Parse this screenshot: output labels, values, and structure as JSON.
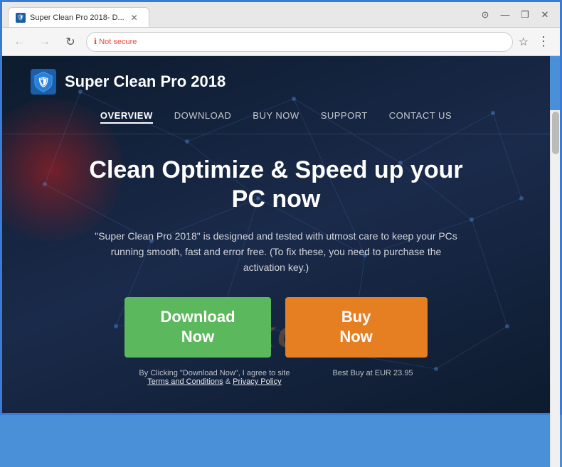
{
  "browser": {
    "tab_title": "Super Clean Pro 2018- D...",
    "tab_favicon": "🛡",
    "window_controls": {
      "account_icon": "⊙",
      "minimize": "—",
      "restore": "❐",
      "close": "✕"
    },
    "nav": {
      "back": "←",
      "forward": "→",
      "refresh": "↻",
      "security_label": "Not secure",
      "address": "",
      "star": "☆",
      "more": "⋮"
    }
  },
  "site": {
    "logo_text": "🛡",
    "title": "Super Clean Pro 2018",
    "nav_items": [
      {
        "label": "OVERVIEW",
        "active": true
      },
      {
        "label": "DOWNLOAD",
        "active": false
      },
      {
        "label": "BUY NOW",
        "active": false
      },
      {
        "label": "SUPPORT",
        "active": false
      },
      {
        "label": "CONTACT US",
        "active": false
      }
    ],
    "hero": {
      "title_line1": "Clean Optimize & Speed up your",
      "title_line2": "PC now",
      "description": "\"Super Clean Pro 2018\" is designed and tested with utmost care to keep your PCs running smooth, fast and error free. (To fix these, you need to purchase the activation key.)",
      "btn_download_line1": "Download",
      "btn_download_line2": "Now",
      "btn_buy_line1": "Buy",
      "btn_buy_line2": "Now",
      "footnote_left_text": "By Clicking \"Download Now\", I agree to site",
      "footnote_left_link1": "Terms and Conditions",
      "footnote_left_sep": " & ",
      "footnote_left_link2": "Privacy Policy",
      "footnote_right": "Best Buy at EUR 23.95"
    },
    "watermark": "riskcon"
  }
}
